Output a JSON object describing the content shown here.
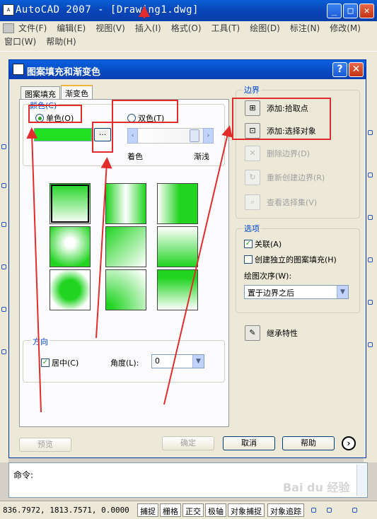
{
  "app": {
    "title": "AutoCAD 2007 - [Drawing1.dwg]",
    "win_min": "_",
    "win_max": "□",
    "win_close": "✕",
    "menu_row1": [
      "文件(F)",
      "编辑(E)",
      "视图(V)",
      "插入(I)",
      "格式(O)",
      "工具(T)",
      "绘图(D)",
      "标注(N)",
      "修改(M)"
    ],
    "menu_row2": [
      "窗口(W)",
      "帮助(H)"
    ]
  },
  "dialog": {
    "title": "图案填充和渐变色",
    "help_btn": "?",
    "close_btn": "✕",
    "tabs": [
      "图案填充",
      "渐变色"
    ],
    "color_group": "颜色(C)",
    "radio_single": "单色(O)",
    "radio_double": "双色(T)",
    "browse_btn": "...",
    "slider_left": "‹",
    "slider_right": "›",
    "shade_label": "着色",
    "tint_label": "渐浅",
    "orientation_group": "方向",
    "centered_label": "居中(C)",
    "angle_label": "角度(L):",
    "angle_value": "0",
    "boundary_group": "边界",
    "boundary_items": [
      {
        "label": "添加:拾取点",
        "enabled": true
      },
      {
        "label": "添加:选择对象",
        "enabled": true
      },
      {
        "label": "删除边界(D)",
        "enabled": false
      },
      {
        "label": "重新创建边界(R)",
        "enabled": false
      },
      {
        "label": "查看选择集(V)",
        "enabled": false
      }
    ],
    "options_group": "选项",
    "associative_label": "关联(A)",
    "separate_label": "创建独立的图案填充(H)",
    "draw_order_label": "绘图次序(W):",
    "draw_order_value": "置于边界之后",
    "inherit_label": "继承特性",
    "preview_btn": "预览",
    "ok_btn": "确定",
    "cancel_btn": "取消",
    "help_button": "帮助",
    "more_btn": "›"
  },
  "colors": {
    "gradient_color": "#22e022",
    "annotation_red": "#e22b2b",
    "title_blue": "#0a4fcc"
  },
  "command": {
    "prompt": "命令:"
  },
  "status": {
    "coords": "836.7972,  1813.7571, 0.0000",
    "toggles": [
      "捕捉",
      "栅格",
      "正交",
      "极轴",
      "对象捕捉",
      "对象追踪"
    ]
  }
}
